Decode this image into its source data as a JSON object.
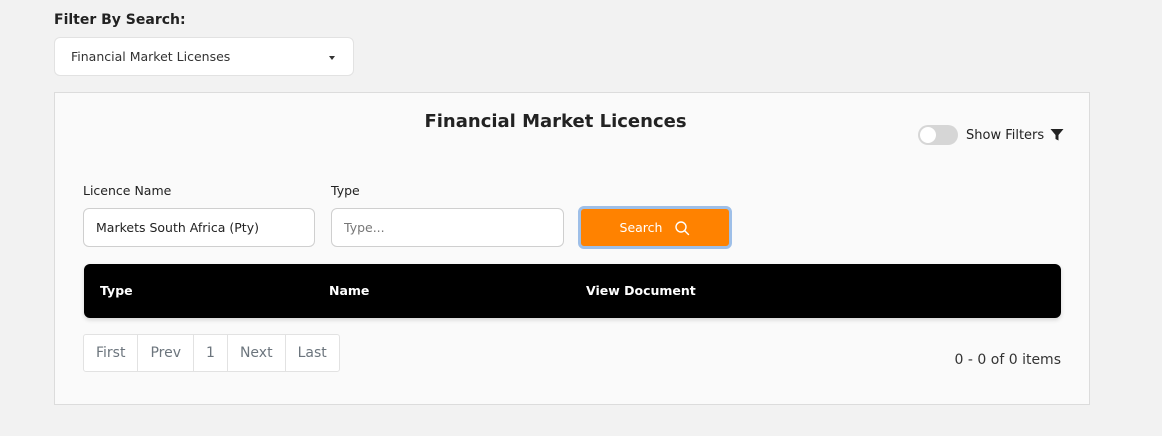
{
  "filter": {
    "label": "Filter By Search:",
    "selected": "Financial Market Licenses"
  },
  "panel": {
    "title": "Financial Market Licences",
    "show_filters_label": "Show Filters",
    "show_filters_on": false
  },
  "form": {
    "licence_name_label": "Licence Name",
    "licence_name_value": "Markets South Africa (Pty)",
    "type_label": "Type",
    "type_placeholder": "Type...",
    "type_value": "",
    "search_label": "Search"
  },
  "table": {
    "columns": [
      "Type",
      "Name",
      "View Document"
    ]
  },
  "pagination": {
    "first": "First",
    "prev": "Prev",
    "page": "1",
    "next": "Next",
    "last": "Last",
    "summary": "0 - 0 of 0 items"
  },
  "icons": {
    "dropdown": "chevron-down-icon",
    "filter": "funnel-icon",
    "search": "magnifier-icon"
  },
  "colors": {
    "accent": "#ff8200",
    "header_bg": "#000000",
    "focus_ring": "#9ebfe8"
  }
}
